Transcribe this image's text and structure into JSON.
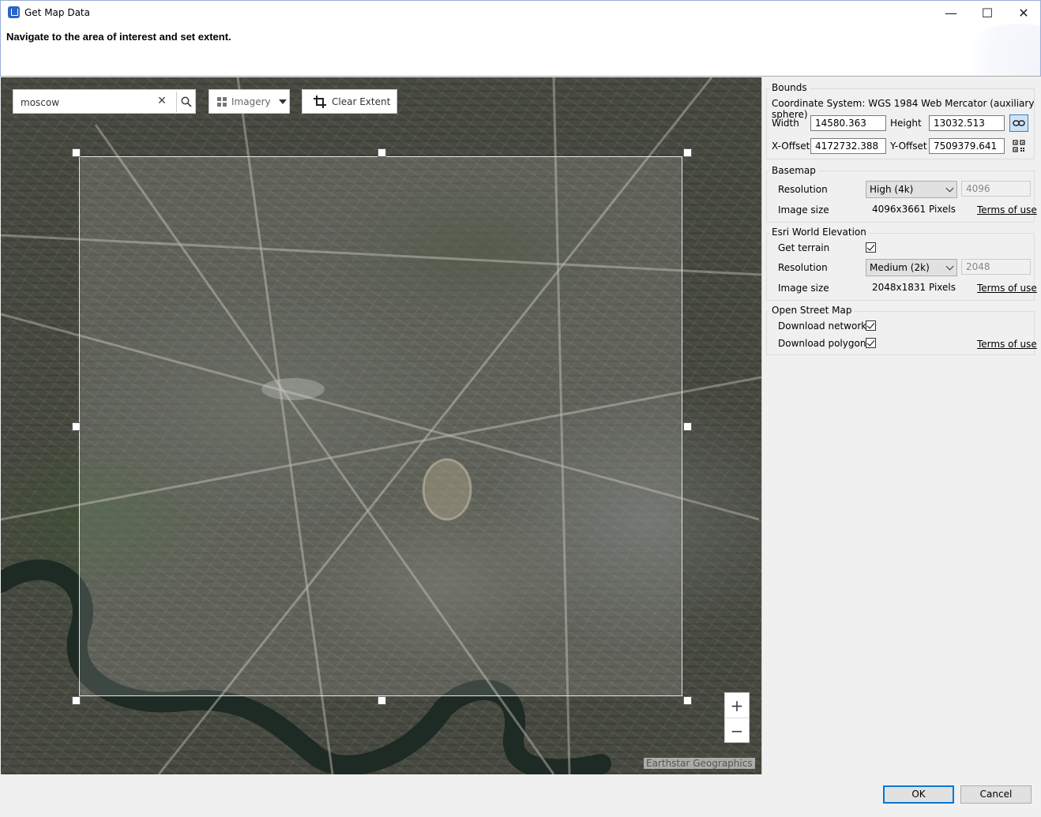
{
  "window": {
    "title": "Get Map Data",
    "controls": {
      "minimize": "—",
      "maximize": "☐",
      "close": "✕"
    }
  },
  "header": {
    "instruction": "Navigate to the area of interest and set extent."
  },
  "map": {
    "search": {
      "value": "moscow",
      "clear_icon": "✕"
    },
    "basemap_dropdown": "Imagery",
    "clear_extent_label": "Clear Extent",
    "zoom_in": "+",
    "zoom_out": "−",
    "attribution": "Earthstar Geographics"
  },
  "bounds": {
    "title": "Bounds",
    "coordinate_system": "Coordinate System: WGS 1984 Web Mercator (auxiliary sphere)",
    "width_label": "Width",
    "width_value": "14580.363",
    "height_label": "Height",
    "height_value": "13032.513",
    "xoffset_label": "X-Offset",
    "xoffset_value": "4172732.388",
    "yoffset_label": "Y-Offset",
    "yoffset_value": "7509379.641"
  },
  "basemap": {
    "title": "Basemap",
    "resolution_label": "Resolution",
    "resolution_value": "High (4k)",
    "resolution_pixels": "4096",
    "image_size_label": "Image size",
    "image_size_value": "4096x3661 Pixels",
    "terms": "Terms of use"
  },
  "elevation": {
    "title": "Esri World Elevation",
    "get_terrain_label": "Get terrain",
    "get_terrain_checked": true,
    "resolution_label": "Resolution",
    "resolution_value": "Medium (2k)",
    "resolution_pixels": "2048",
    "image_size_label": "Image size",
    "image_size_value": "2048x1831 Pixels",
    "terms": "Terms of use"
  },
  "osm": {
    "title": "Open Street Map",
    "networks_label": "Download networks",
    "networks_checked": true,
    "polygons_label": "Download polygons",
    "polygons_checked": true,
    "terms": "Terms of use"
  },
  "footer": {
    "ok": "OK",
    "cancel": "Cancel"
  }
}
